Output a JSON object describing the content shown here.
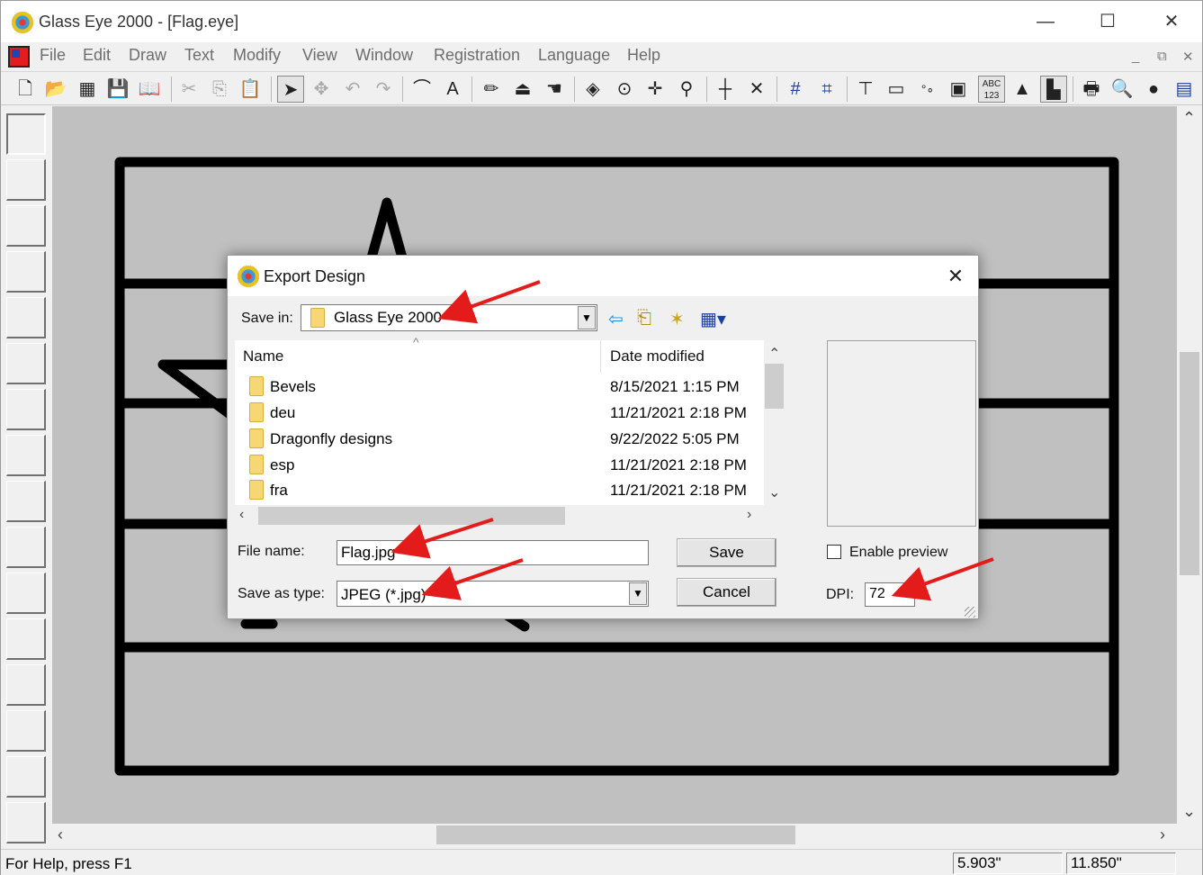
{
  "app": {
    "title": "Glass Eye 2000 - [Flag.eye]",
    "window_controls": {
      "minimize": "—",
      "maximize": "☐",
      "close": "✕"
    }
  },
  "menu": {
    "items": [
      "File",
      "Edit",
      "Draw",
      "Text",
      "Modify",
      "View",
      "Window",
      "Registration",
      "Language",
      "Help"
    ],
    "mdi_controls": {
      "minimize": "_",
      "restore": "⧉",
      "close": "✕"
    }
  },
  "toolbar": {
    "icons": [
      "new-icon",
      "open-icon",
      "grid-icon",
      "save-icon",
      "library-icon",
      "cut-icon",
      "copy-icon",
      "paste-icon",
      "pointer-icon",
      "node-icon",
      "undo-icon",
      "redo-icon",
      "curve-icon",
      "text-icon",
      "pencil-icon",
      "raise-icon",
      "hand-icon",
      "fill-icon",
      "circle-icon",
      "move-icon",
      "zoom-icon",
      "line-icon",
      "cross-icon",
      "grid-lines-icon",
      "snap-grid-icon",
      "measure-icon",
      "ruler-icon",
      "dots-icon",
      "colors-icon",
      "numbers-icon",
      "glass-icon",
      "layout-icon",
      "print-icon",
      "print-preview-icon",
      "bomb-icon",
      "calendar-icon"
    ],
    "numbers_label": "ABC 123"
  },
  "dialog": {
    "title": "Export Design",
    "close": "✕",
    "save_in_label": "Save in:",
    "save_in_value": "Glass Eye 2000",
    "columns": {
      "name": "Name",
      "date": "Date modified"
    },
    "files": [
      {
        "name": "Bevels",
        "date": "8/15/2021 1:15 PM"
      },
      {
        "name": "deu",
        "date": "11/21/2021 2:18 PM"
      },
      {
        "name": "Dragonfly designs",
        "date": "9/22/2022 5:05 PM"
      },
      {
        "name": "esp",
        "date": "11/21/2021 2:18 PM"
      },
      {
        "name": "fra",
        "date": "11/21/2021 2:18 PM"
      }
    ],
    "file_name_label": "File name:",
    "file_name_value": "Flag.jpg",
    "save_as_type_label": "Save as type:",
    "save_as_type_value": "JPEG (*.jpg)",
    "save_button": "Save",
    "cancel_button": "Cancel",
    "enable_preview_label": "Enable preview",
    "enable_preview_checked": false,
    "dpi_label": "DPI:",
    "dpi_value": "72"
  },
  "status": {
    "help": "For Help, press F1",
    "coord_x": "5.903\"",
    "coord_y": "11.850\""
  },
  "colors": {
    "canvas_bg": "#c0c0c0",
    "annotation_arrow": "#e31b1b",
    "folder": "#f7d774"
  }
}
